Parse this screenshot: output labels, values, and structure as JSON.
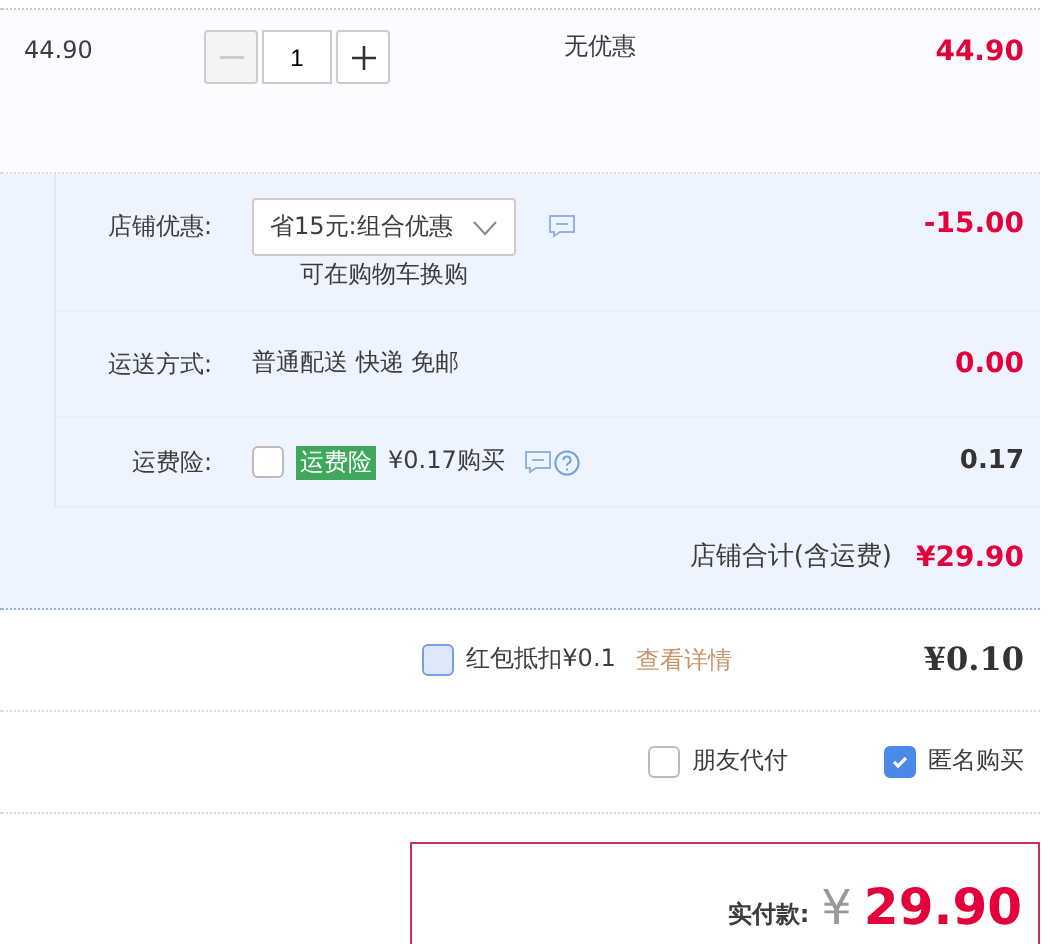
{
  "item": {
    "unit_price": "44.90",
    "quantity": "1",
    "minus_disabled": true,
    "discount": "无优惠",
    "subtotal": "44.90"
  },
  "shop_discount": {
    "label": "店铺优惠:",
    "option": "省15元:组合优惠",
    "hint": "可在购物车换购",
    "amount": "-15.00"
  },
  "shipping": {
    "label": "运送方式:",
    "value": "普通配送 快递 免邮",
    "amount": "0.00"
  },
  "insurance": {
    "label": "运费险:",
    "checked": false,
    "tag": "运费险",
    "price": "¥0.17购买",
    "amount": "0.17"
  },
  "shop_total": {
    "label": "店铺合计(含运费)",
    "amount": "¥29.90"
  },
  "red_packet": {
    "checked": false,
    "label": "红包抵扣¥0.1",
    "link": "查看详情",
    "amount": "¥0.10"
  },
  "options": [
    {
      "label": "朋友代付",
      "checked": false
    },
    {
      "label": "匿名购买",
      "checked": true
    }
  ],
  "payment": {
    "label": "实付款:",
    "currency": "¥",
    "amount": "29.90"
  }
}
